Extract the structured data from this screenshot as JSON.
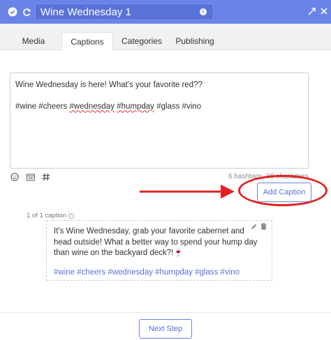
{
  "header": {
    "title": "Wine Wednesday 1",
    "info_icon": "i",
    "color": "#6a83e6"
  },
  "tabs": [
    {
      "label": "Media",
      "active": false
    },
    {
      "label": "Captions",
      "active": true
    },
    {
      "label": "Categories",
      "active": false
    },
    {
      "label": "Publishing",
      "active": false
    }
  ],
  "editor": {
    "line1": "Wine Wednesday is here! What's your favorite red??",
    "tags": [
      "#wine",
      "#cheers",
      "#wednesday",
      "#humpday",
      "#glass",
      "#vino"
    ],
    "counter": "6 hashtags, 98 characters"
  },
  "add_caption_label": "Add Caption",
  "caption_count": "1 of 1 caption",
  "caption": {
    "body": "It's Wine Wednesday, grab your favorite cabernet and head outside! What a better way to spend your hump day than wine on the backyard deck?!",
    "emoji": "🍷",
    "tags": [
      "#wine",
      "#cheers",
      "#wednesday",
      "#humpday",
      "#glass",
      "#vino"
    ]
  },
  "next_step_label": "Next Step",
  "icons": [
    "check-circle-icon",
    "refresh-icon",
    "info-icon",
    "expand-icon",
    "close-icon",
    "emoji-icon",
    "library-icon",
    "hashtag-tool-icon",
    "edit-icon",
    "trash-icon",
    "arrow-icon"
  ]
}
